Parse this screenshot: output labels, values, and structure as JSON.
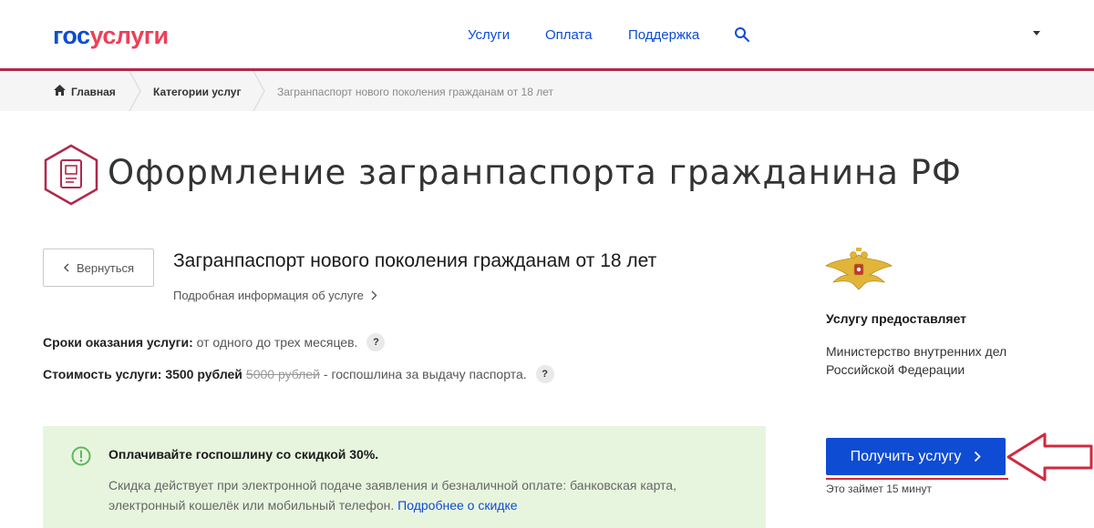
{
  "header": {
    "logo": {
      "part1": "гос",
      "part2": "услуги"
    },
    "nav": [
      {
        "label": "Услуги"
      },
      {
        "label": "Оплата"
      },
      {
        "label": "Поддержка"
      }
    ],
    "search_icon": "search-icon",
    "menu_icon": "caret-down-icon",
    "accent_line_color": "#b0284d"
  },
  "breadcrumb": {
    "home": "Главная",
    "items": [
      "Категории услуг",
      "Загранпаспорт нового поколения гражданам от 18 лет"
    ]
  },
  "page": {
    "title": "Оформление загранпаспорта гражданина РФ",
    "title_icon": "passport-icon"
  },
  "service": {
    "back_label": "Вернуться",
    "title": "Загранпаспорт нового поколения гражданам от 18 лет",
    "details_link": "Подробная информация об услуге",
    "term_label": "Сроки оказания услуги:",
    "term_value": "от одного до трех месяцев.",
    "cost_label": "Стоимость услуги:",
    "cost_value": "3500 рублей",
    "cost_old": "5000 рублей",
    "cost_note": "- госпошлина за выдачу паспорта.",
    "help_mark": "?"
  },
  "discount": {
    "title": "Оплачивайте госпошлину со скидкой 30%.",
    "text": "Скидка действует при электронной подаче заявления и безналичной оплате: банковская карта, электронный кошелёк или мобильный телефон.",
    "link": "Подробнее о скидке",
    "background": "#e8f5de",
    "icon": "exclamation-circle-icon"
  },
  "provider": {
    "emblem_icon": "coat-of-arms-icon",
    "label": "Услугу предоставляет",
    "name": "Министерство внутренних дел Российской Федерации"
  },
  "action": {
    "button_label": "Получить услугу",
    "duration": "Это займет 15 минут",
    "button_color": "#0d4cd3",
    "annotation_icon": "red-arrow-icon"
  }
}
